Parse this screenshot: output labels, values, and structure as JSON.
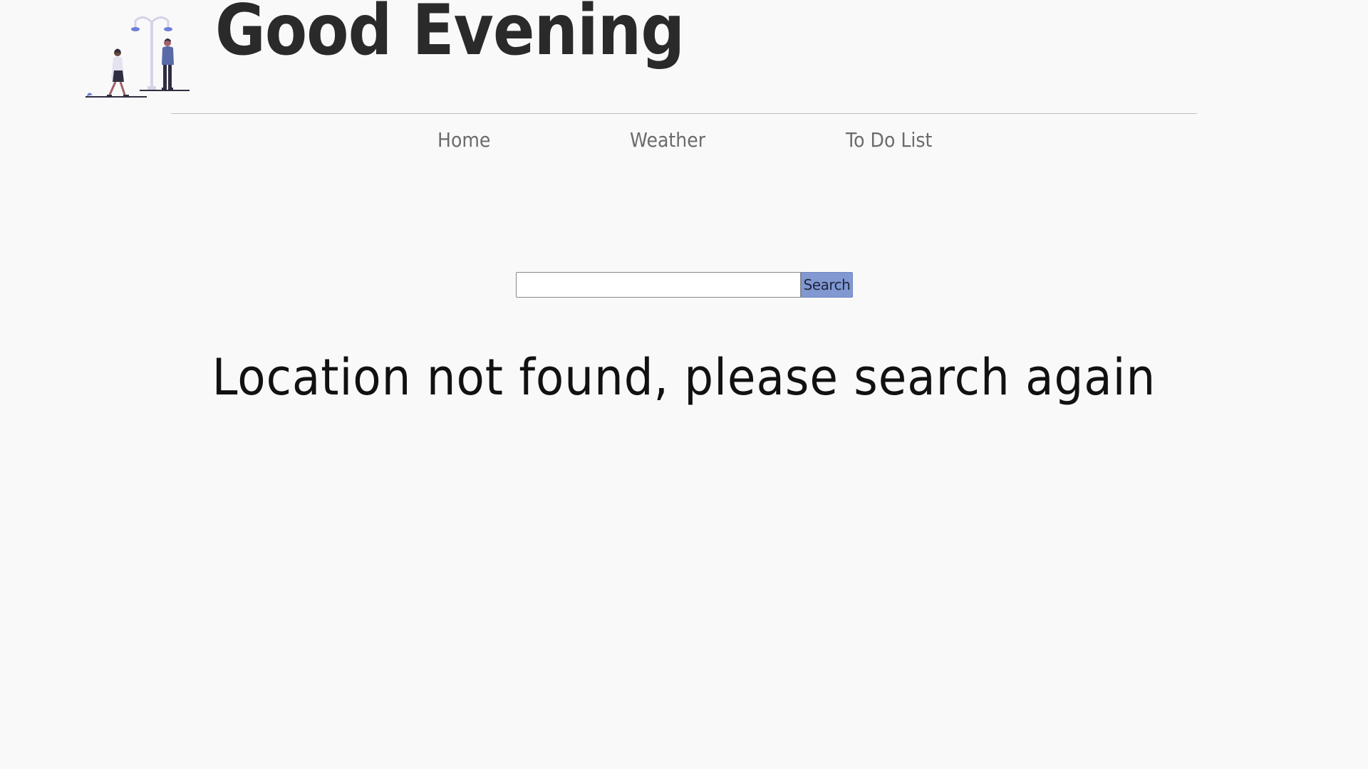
{
  "header": {
    "title": "Good Evening",
    "logo_icon": "street-lamp-people-illustration"
  },
  "nav": {
    "items": [
      {
        "label": "Home"
      },
      {
        "label": "Weather"
      },
      {
        "label": "To Do List"
      }
    ]
  },
  "search": {
    "value": "",
    "placeholder": "",
    "button_label": "Search"
  },
  "status": {
    "message": "Location not found, please search again"
  },
  "colors": {
    "background": "#f9f9f9",
    "accent": "#8198d1",
    "title": "#2a2a2a",
    "nav_text": "#6b6b6b"
  }
}
